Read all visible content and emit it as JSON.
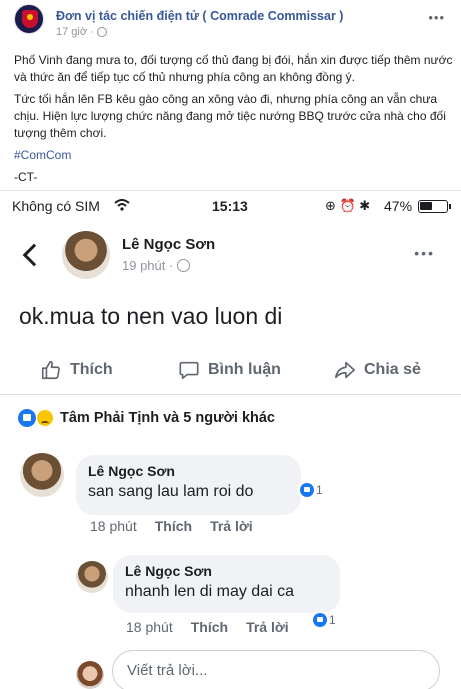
{
  "post": {
    "page_name": "Đơn vị tác chiến điện tử ( Comrade Commissar )",
    "time": "17 giờ ·",
    "more": "•••",
    "paragraphs": [
      "Phố Vinh đang mưa to, đối tượng cố thủ đang bị đói, hắn xin được tiếp thêm nước và thức ăn để tiếp tục cố thủ nhưng phía công an không đồng ý.",
      "Tức tối hắn lên FB kêu gào công an xông vào đi, nhưng phía công an vẫn chưa chịu. Hiện lực lượng chức năng đang mở tiệc nướng BBQ trước cửa nhà cho đối tượng thêm chơi."
    ],
    "hashtag": "#ComCom",
    "signature": "-CT-"
  },
  "screenshot": {
    "status_bar": {
      "carrier": "Không có SIM",
      "clock": "15:13",
      "icons": "⊕ ⏰ ✱",
      "battery_pct": "47%",
      "battery_level": 0.47
    },
    "inner_post": {
      "author": "Lê Ngọc Sơn",
      "time": "19 phút ·",
      "more": "•••",
      "text": "ok.mua to nen vao luon di"
    },
    "actions": {
      "like": "Thích",
      "comment": "Bình luận",
      "share": "Chia sẻ"
    },
    "reactions_summary": "Tâm Phải Tịnh và 5 người khác",
    "comments": [
      {
        "author": "Lê Ngọc Sơn",
        "text": "san sang lau lam roi do",
        "time": "18 phút",
        "like": "Thích",
        "reply": "Trả lời",
        "likes": "1"
      },
      {
        "author": "Lê Ngọc Sơn",
        "text": "nhanh len di may dai ca",
        "time": "18 phút",
        "like": "Thích",
        "reply": "Trả lời",
        "likes": "1"
      }
    ],
    "reply_placeholder": "Viết trả lời..."
  },
  "colors": {
    "link": "#385898",
    "facebook_blue": "#1877f2",
    "muted": "#606770"
  }
}
